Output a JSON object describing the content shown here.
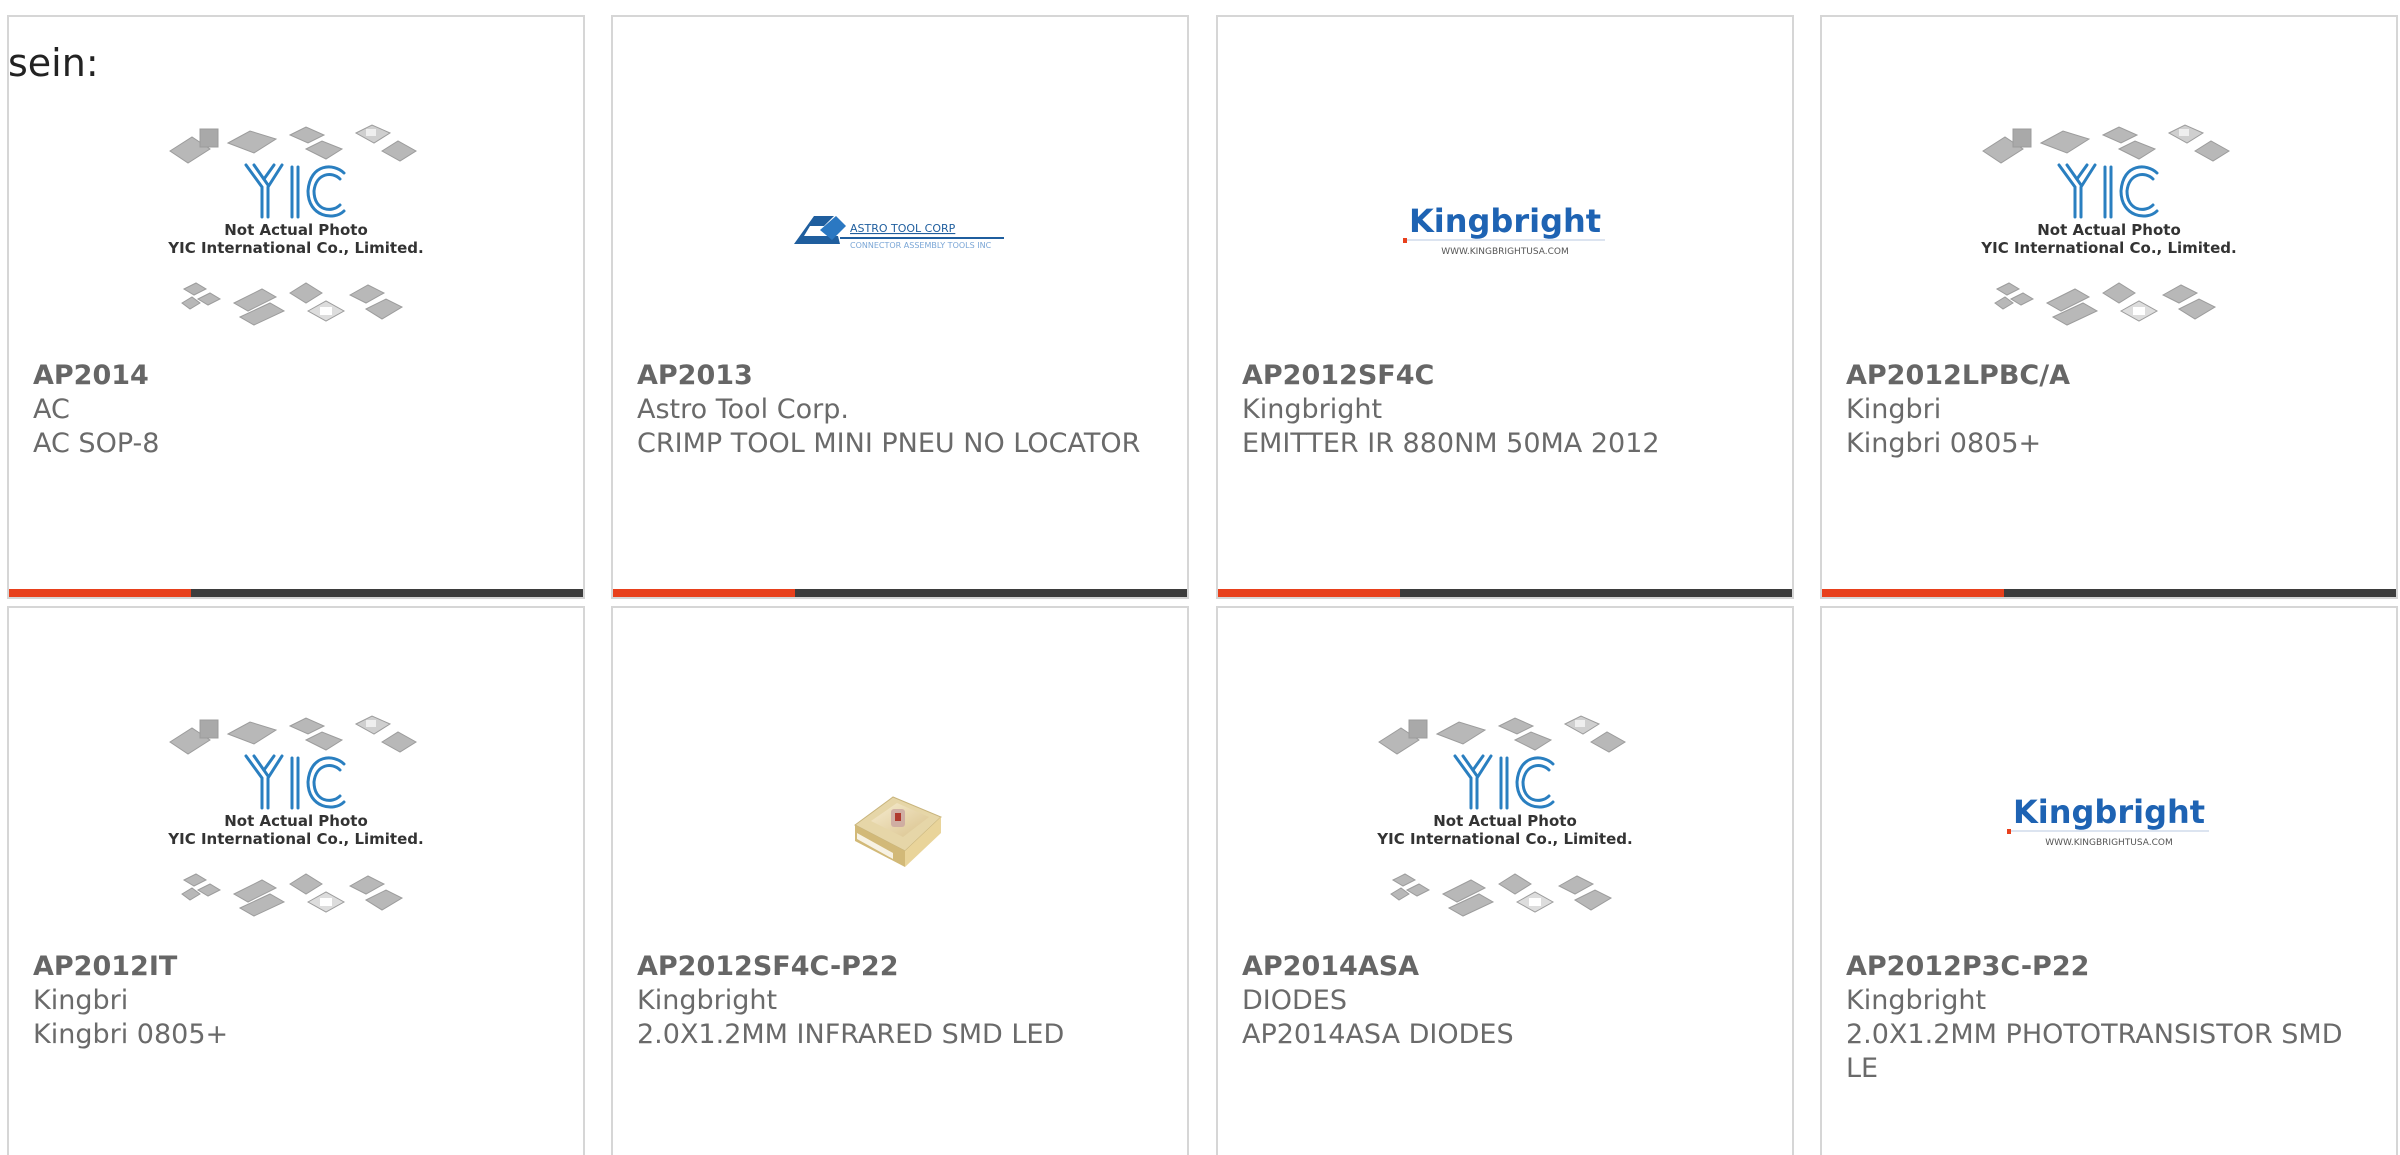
{
  "intro_text": "sein:",
  "colors": {
    "accent_bar": "#e8401c",
    "dark_bar": "#3d3d3d",
    "yic_blue": "#2a7fc0",
    "kingbright_blue": "#1e63b3"
  },
  "products": [
    {
      "part": "AP2014",
      "manufacturer": "AC",
      "description": "AC SOP-8",
      "image": "yic-placeholder",
      "image_text": {
        "line1": "Not Actual Photo",
        "line2": "YIC International Co., Limited."
      }
    },
    {
      "part": "AP2013",
      "manufacturer": "Astro Tool Corp.",
      "description": "CRIMP TOOL MINI PNEU NO LOCATOR",
      "image": "astro-logo",
      "image_text": {
        "line1": "ASTRO TOOL CORP",
        "line2": "CONNECTOR ASSEMBLY TOOLS INC"
      }
    },
    {
      "part": "AP2012SF4C",
      "manufacturer": "Kingbright",
      "description": "EMITTER IR 880NM 50MA 2012",
      "image": "kingbright-logo",
      "image_text": {
        "line1": "Kingbright",
        "line2": "WWW.KINGBRIGHTUSA.COM"
      }
    },
    {
      "part": "AP2012LPBC/A",
      "manufacturer": "Kingbri",
      "description": "Kingbri 0805+",
      "image": "yic-placeholder",
      "image_text": {
        "line1": "Not Actual Photo",
        "line2": "YIC International Co., Limited."
      }
    },
    {
      "part": "AP2012IT",
      "manufacturer": "Kingbri",
      "description": "Kingbri 0805+",
      "image": "yic-placeholder",
      "image_text": {
        "line1": "Not Actual Photo",
        "line2": "YIC International Co., Limited."
      }
    },
    {
      "part": "AP2012SF4C-P22",
      "manufacturer": "Kingbright",
      "description": "2.0X1.2MM INFRARED SMD LED",
      "image": "smd-led-photo",
      "image_text": {
        "line1": "",
        "line2": ""
      }
    },
    {
      "part": "AP2014ASA",
      "manufacturer": "DIODES",
      "description": "AP2014ASA DIODES",
      "image": "yic-placeholder",
      "image_text": {
        "line1": "Not Actual Photo",
        "line2": "YIC International Co., Limited."
      }
    },
    {
      "part": "AP2012P3C-P22",
      "manufacturer": "Kingbright",
      "description": "2.0X1.2MM PHOTOTRANSISTOR SMD LE",
      "image": "kingbright-logo",
      "image_text": {
        "line1": "Kingbright",
        "line2": "WWW.KINGBRIGHTUSA.COM"
      }
    }
  ]
}
